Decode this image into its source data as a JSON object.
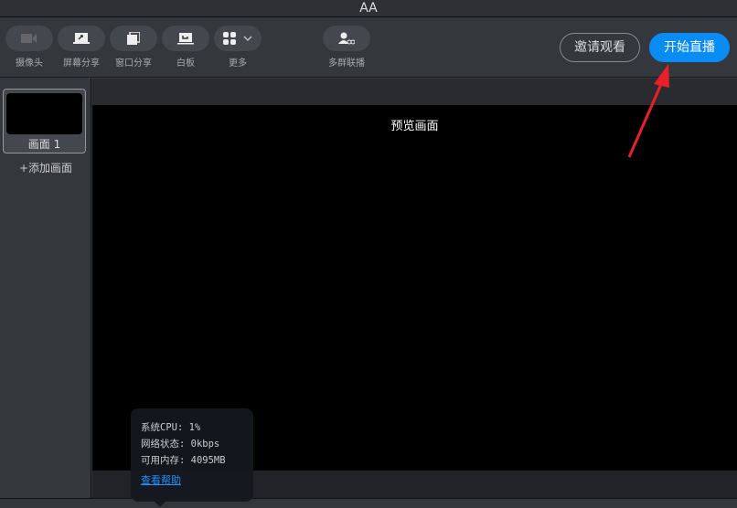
{
  "window": {
    "title": "AA"
  },
  "toolbar": {
    "camera": "摄像头",
    "screen_share": "屏幕分享",
    "window_share": "窗口分享",
    "whiteboard": "白板",
    "more": "更多",
    "multi_group": "多群联播",
    "invite": "邀请观看",
    "start_live": "开始直播"
  },
  "sidebar": {
    "scenes": [
      {
        "label": "画面 1"
      }
    ],
    "add_scene": "+添加画面"
  },
  "preview": {
    "title": "预览画面"
  },
  "stats": {
    "cpu": "系统CPU: 1%",
    "network": "网络状态: 0kbps",
    "memory": "可用内存: 4095MB",
    "help": "查看帮助"
  },
  "colors": {
    "accent": "#0a8cf5",
    "annotation_arrow": "#e8202a"
  }
}
